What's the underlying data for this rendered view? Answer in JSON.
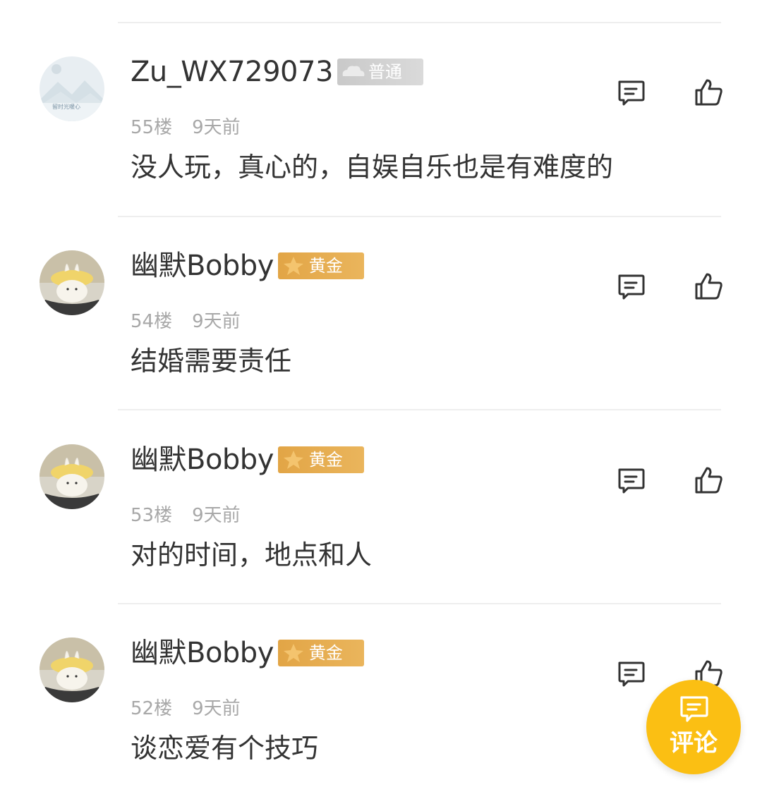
{
  "comments": [
    {
      "username": "Zu_WX729073",
      "badge": "普通",
      "badge_tier": "normal",
      "floor": "55楼",
      "time": "9天前",
      "content": "没人玩，真心的，自娱自乐也是有难度的",
      "avatar_text": "留时光暖心"
    },
    {
      "username": "幽默Bobby",
      "badge": "黄金",
      "badge_tier": "gold",
      "floor": "54楼",
      "time": "9天前",
      "content": "结婚需要责任"
    },
    {
      "username": "幽默Bobby",
      "badge": "黄金",
      "badge_tier": "gold",
      "floor": "53楼",
      "time": "9天前",
      "content": "对的时间，地点和人"
    },
    {
      "username": "幽默Bobby",
      "badge": "黄金",
      "badge_tier": "gold",
      "floor": "52楼",
      "time": "9天前",
      "content": "谈恋爱有个技巧"
    }
  ],
  "fab": {
    "label": "评论",
    "icon": "comment-icon",
    "color": "#fbbf13"
  },
  "icons": {
    "reply": "reply-icon",
    "like": "thumbs-up-icon"
  },
  "colors": {
    "gold_badge": "#e2a546",
    "normal_badge": "#cccccc",
    "meta_text": "#a8a8a8",
    "body_text": "#333333"
  }
}
